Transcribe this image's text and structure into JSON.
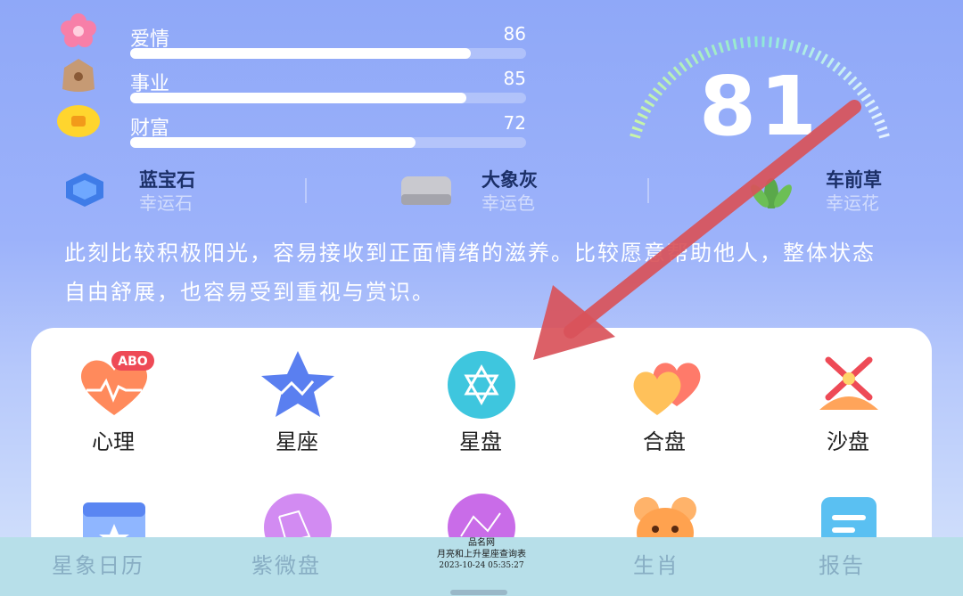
{
  "stats": [
    {
      "label": "爱情",
      "value": "86",
      "level": 0.86,
      "icon": "flower-icon"
    },
    {
      "label": "事业",
      "value": "85",
      "level": 0.85,
      "icon": "briefcase-icon"
    },
    {
      "label": "财富",
      "value": "72",
      "level": 0.72,
      "icon": "coin-icon"
    }
  ],
  "score": {
    "value": "81"
  },
  "lucky": [
    {
      "name": "蓝宝石",
      "sub": "幸运石",
      "icon": "sapphire-icon"
    },
    {
      "name": "大象灰",
      "sub": "幸运色",
      "icon": "color-swatch-icon"
    },
    {
      "name": "车前草",
      "sub": "幸运花",
      "icon": "plant-icon"
    }
  ],
  "description": "此刻比较积极阳光，容易接收到正面情绪的滋养。比较愿意帮助他人，整体状态自由舒展，也容易受到重视与赏识。",
  "grid": {
    "row1": [
      {
        "label": "心理",
        "icon": "heart-abo-icon",
        "badge": "ABO"
      },
      {
        "label": "星座",
        "icon": "star-icon"
      },
      {
        "label": "星盘",
        "icon": "star-of-david-icon"
      },
      {
        "label": "合盘",
        "icon": "double-heart-icon"
      },
      {
        "label": "沙盘",
        "icon": "windmill-icon"
      }
    ],
    "row2": [
      {
        "icon": "calendar-star-icon"
      },
      {
        "icon": "purple-chart-icon"
      },
      {
        "icon": "constellation-icon"
      },
      {
        "icon": "mouse-icon"
      },
      {
        "icon": "report-icon"
      }
    ]
  },
  "bottom_nav": [
    {
      "label": "星象日历"
    },
    {
      "label": "紫微盘"
    },
    {
      "label": "生肖"
    },
    {
      "label": "报告"
    }
  ],
  "watermark": {
    "line1": "品名网",
    "line2": "月亮和上升星座查询表",
    "line3": "2023-10-24 05:35:27"
  },
  "colors": {
    "accent_arrow": "#d9535a",
    "lucky_name": "#1b2f67",
    "nav_bg": "#b7dfe9"
  }
}
